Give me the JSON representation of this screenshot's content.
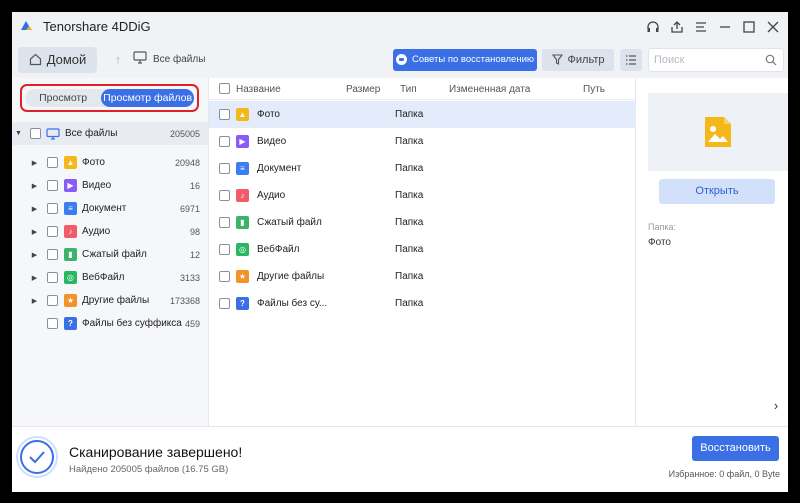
{
  "app": {
    "title": "Tenorshare 4DDiG"
  },
  "toolbar": {
    "home_label": "Домой",
    "breadcrumb": "Все файлы",
    "tips_label": "Советы по восстановлению",
    "filter_label": "Фильтр",
    "search_placeholder": "Поиск"
  },
  "sidebar": {
    "view_tabs": [
      "Просмотр",
      "Просмотр файлов"
    ],
    "root": {
      "label": "Все файлы",
      "count": "205005"
    },
    "items": [
      {
        "label": "Фото",
        "count": "20948",
        "icon": "photo-icon",
        "color": "#f5b81a"
      },
      {
        "label": "Видео",
        "count": "16",
        "icon": "video-icon",
        "color": "#8a5cf6"
      },
      {
        "label": "Документ",
        "count": "6971",
        "icon": "document-icon",
        "color": "#3a7ef0"
      },
      {
        "label": "Аудио",
        "count": "98",
        "icon": "audio-icon",
        "color": "#f25c6a"
      },
      {
        "label": "Сжатый файл",
        "count": "12",
        "icon": "archive-icon",
        "color": "#3bb46a"
      },
      {
        "label": "ВебФайл",
        "count": "3133",
        "icon": "web-icon",
        "color": "#28b864"
      },
      {
        "label": "Другие файлы",
        "count": "173368",
        "icon": "other-files-icon",
        "color": "#f3922b"
      },
      {
        "label": "Файлы без суффикса",
        "count": "459",
        "icon": "unknown-file-icon",
        "color": "#3a6fe6"
      }
    ]
  },
  "list": {
    "columns": [
      "Название",
      "Размер",
      "Тип",
      "Измененная дата",
      "Путь"
    ],
    "rows": [
      {
        "name": "Фото",
        "type": "Папка",
        "icon": "photo-icon",
        "color": "#f5b81a"
      },
      {
        "name": "Видео",
        "type": "Папка",
        "icon": "video-icon",
        "color": "#8a5cf6"
      },
      {
        "name": "Документ",
        "type": "Папка",
        "icon": "document-icon",
        "color": "#3a7ef0"
      },
      {
        "name": "Аудио",
        "type": "Папка",
        "icon": "audio-icon",
        "color": "#f25c6a"
      },
      {
        "name": "Сжатый файл",
        "type": "Папка",
        "icon": "archive-icon",
        "color": "#3bb46a"
      },
      {
        "name": "ВебФайл",
        "type": "Папка",
        "icon": "web-icon",
        "color": "#28b864"
      },
      {
        "name": "Другие файлы",
        "type": "Папка",
        "icon": "other-files-icon",
        "color": "#f3922b"
      },
      {
        "name": "Файлы без су...",
        "type": "Папка",
        "icon": "unknown-file-icon",
        "color": "#3a6fe6"
      }
    ]
  },
  "preview": {
    "open_label": "Открыть",
    "folder_label": "Папка:",
    "folder_value": "Фото"
  },
  "bottom": {
    "status_title": "Сканирование завершено!",
    "status_sub": "Найдено 205005 файлов (16.75 GB)",
    "recover_label": "Восстановить",
    "selected_info": "Избранное: 0 файл, 0 Byte"
  },
  "colors": {
    "accent": "#3a6fe6",
    "highlight_border": "#e0202a"
  }
}
